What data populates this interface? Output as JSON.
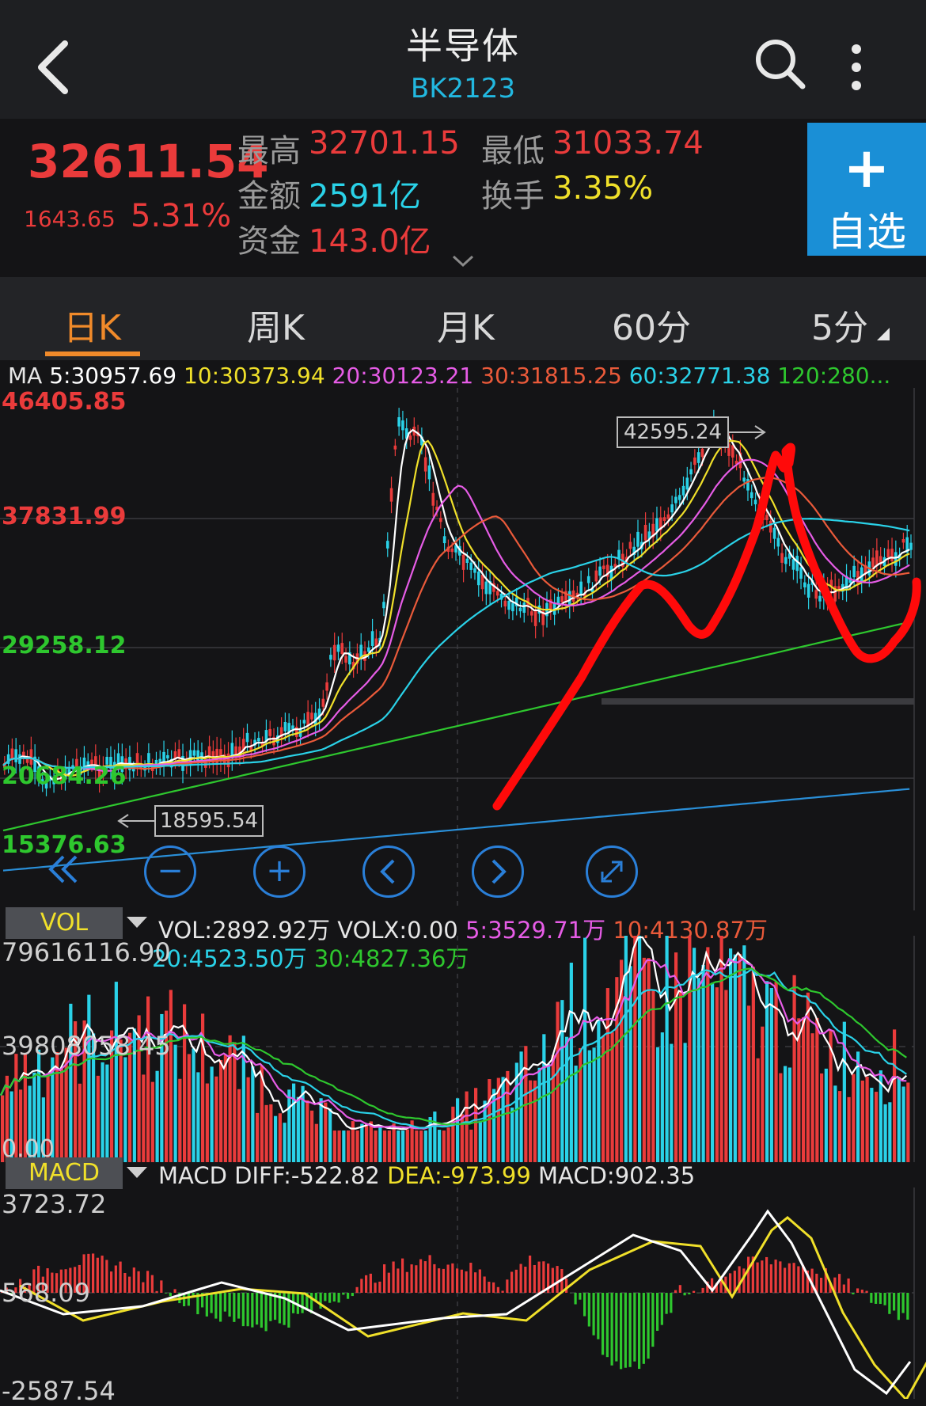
{
  "header": {
    "title": "半导体",
    "code": "BK2123"
  },
  "quote": {
    "price": "32611.54",
    "change": "1643.65",
    "change_pct": "5.31%",
    "high_label": "最高",
    "high": "32701.15",
    "low_label": "最低",
    "low": "31033.74",
    "amount_label": "金额",
    "amount": "2591亿",
    "turnover_label": "换手",
    "turnover": "3.35%",
    "capital_label": "资金",
    "capital": "143.0亿"
  },
  "watchlist_button": {
    "plus": "+",
    "label": "自选"
  },
  "tabs": [
    "日K",
    "周K",
    "月K",
    "60分",
    "5分"
  ],
  "active_tab": 0,
  "ma_line": {
    "prefix": "MA",
    "ma5": "5:30957.69",
    "ma10": "10:30373.94",
    "ma20": "20:30123.21",
    "ma30": "30:31815.25",
    "ma60": "60:32771.38",
    "ma120": "120:280..."
  },
  "price_axis": [
    "46405.85",
    "37831.99",
    "29258.12",
    "20684.26",
    "15376.63"
  ],
  "annotations": {
    "high_marker": "42595.24",
    "low_marker": "18595.54"
  },
  "chart_controls": [
    "double-left-icon",
    "zoom-out-icon",
    "zoom-in-icon",
    "prev-icon",
    "next-icon",
    "fullscreen-icon"
  ],
  "volume": {
    "tag": "VOL",
    "line1": {
      "vol": "VOL:2892.92万",
      "volx": "VOLX:0.00",
      "ma5": "5:3529.71万",
      "ma10": "10:4130.87万"
    },
    "line2": {
      "ma20": "20:4523.50万",
      "ma30": "30:4827.36万"
    },
    "axis": [
      "79616116.90",
      "39808058.45",
      "0.00"
    ]
  },
  "macd": {
    "tag": "MACD",
    "prefix": "MACD",
    "diff": "DIFF:-522.82",
    "dea": "DEA:-973.99",
    "macd": "MACD:902.35",
    "axis": [
      "3723.72",
      "568.09",
      "-2587.54"
    ]
  },
  "colors": {
    "up": "#ea3b3b",
    "down": "#2ad2e8",
    "accent": "#1a8fd6",
    "ma5": "#ffffff",
    "ma10": "#f0e02a",
    "ma20": "#e65ce6",
    "ma30": "#ea5a3a",
    "ma60": "#2ad2e8",
    "ma120": "#2ec72e",
    "ma250": "#2a8fd8",
    "annotation": "#ff0000"
  }
}
